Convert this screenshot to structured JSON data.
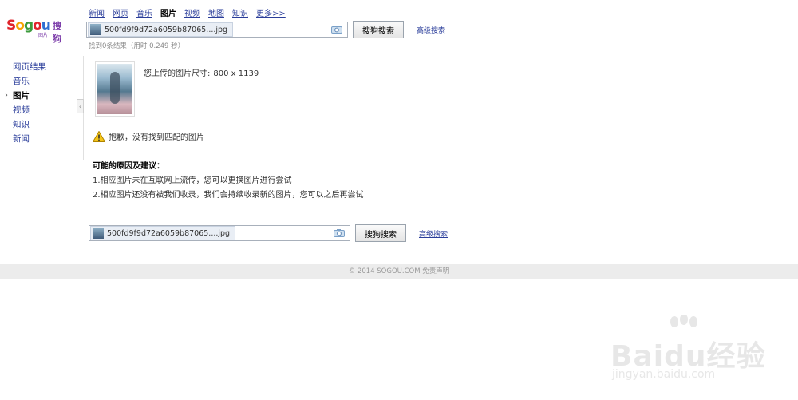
{
  "logo": {
    "wordmark": [
      "S",
      "o",
      "g",
      "o",
      "u"
    ],
    "chinese": "搜狗",
    "sub": "图片"
  },
  "topnav": [
    {
      "label": "新闻"
    },
    {
      "label": "网页"
    },
    {
      "label": "音乐"
    },
    {
      "label": "图片",
      "current": true
    },
    {
      "label": "视频"
    },
    {
      "label": "地图"
    },
    {
      "label": "知识"
    },
    {
      "label": "更多>>"
    }
  ],
  "search": {
    "filename": "500fd9f9d72a6059b87065....jpg",
    "button_label": "搜狗搜索",
    "advanced_label": "高级搜索"
  },
  "stats": "找到0条结果（用时 0.249 秒）",
  "sidebar": {
    "items": [
      {
        "label": "网页结果"
      },
      {
        "label": "音乐"
      },
      {
        "label": "图片",
        "active": true
      },
      {
        "label": "视频"
      },
      {
        "label": "知识"
      },
      {
        "label": "新闻"
      }
    ]
  },
  "upload": {
    "size_label": "您上传的图片尺寸:",
    "size_value": "800 x 1139"
  },
  "warning": "抱歉，没有找到匹配的图片",
  "reasons": {
    "title": "可能的原因及建议：",
    "items": [
      "1.相应图片未在互联网上流传，您可以更换图片进行尝试",
      "2.相应图片还没有被我们收录，我们会持续收录新的图片，您可以之后再尝试"
    ]
  },
  "footer": "© 2014 SOGOU.COM 免责声明",
  "watermark": {
    "word": "Baidu经验",
    "url": "jingyan.baidu.com"
  }
}
